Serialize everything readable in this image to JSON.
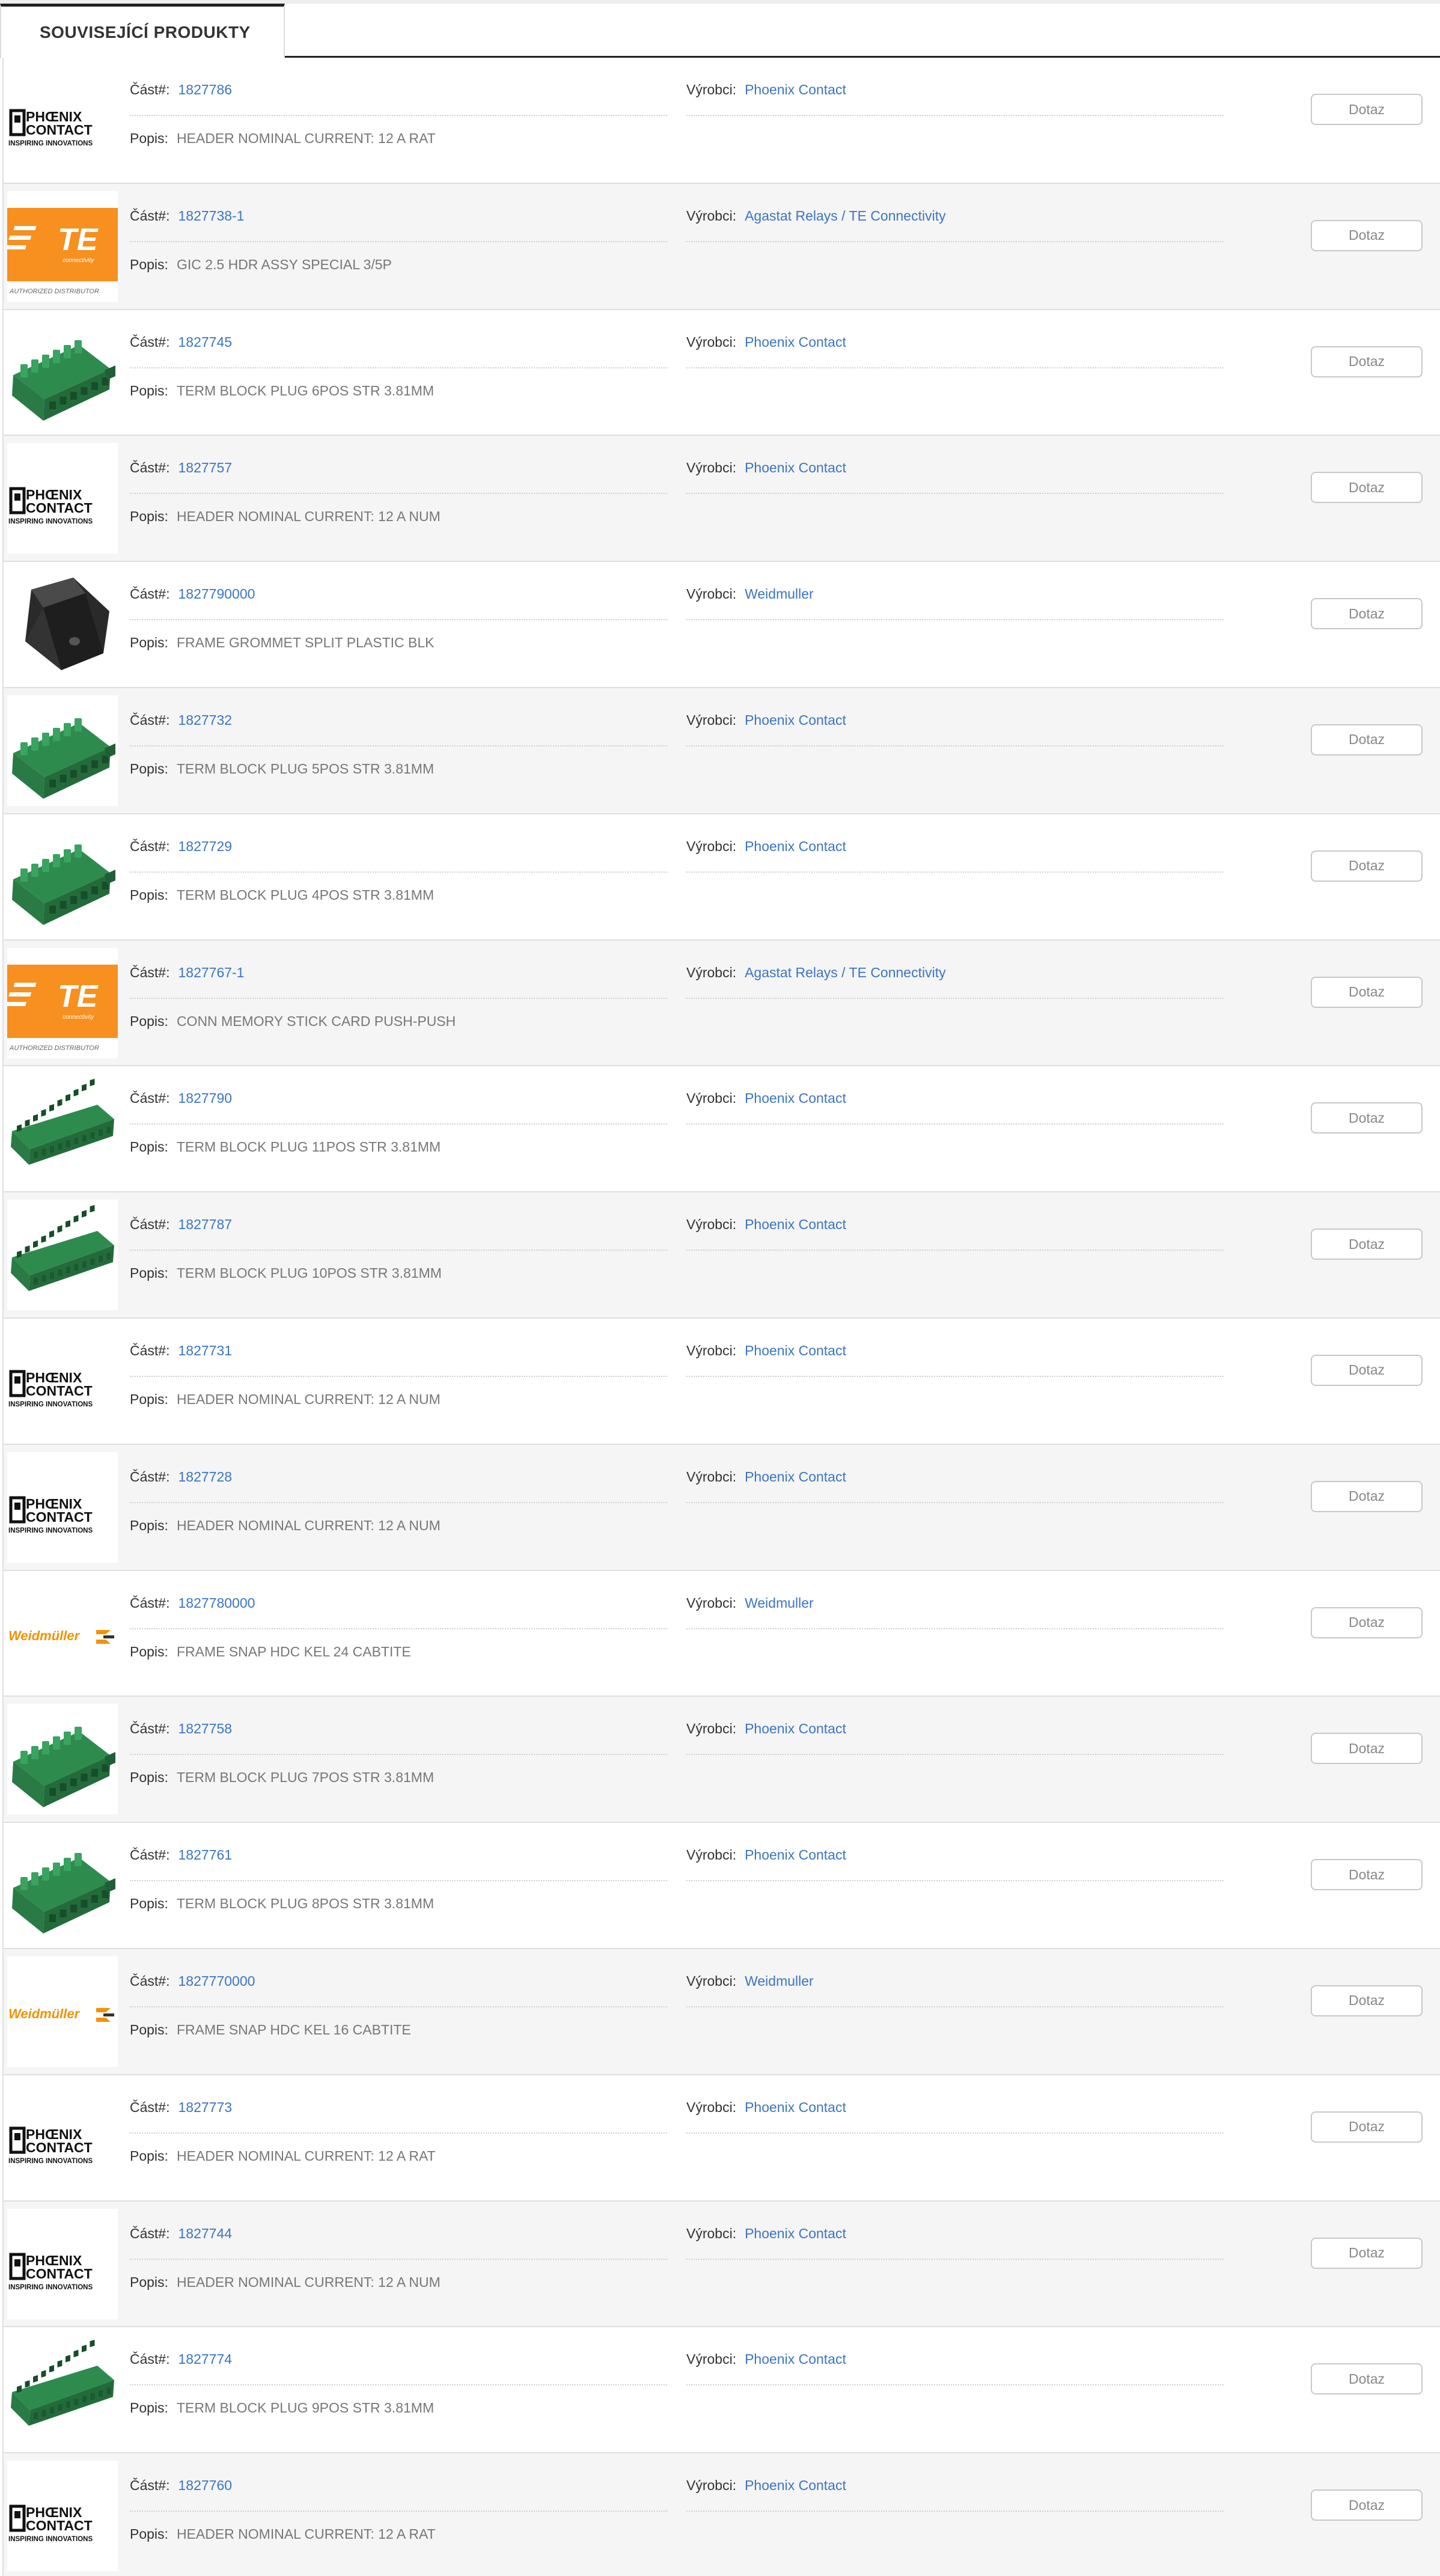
{
  "tab": {
    "label": "SOUVISEJÍCÍ PRODUKTY"
  },
  "labels": {
    "part": "Část#:",
    "manufacturer": "Výrobci:",
    "description": "Popis:",
    "button": "Dotaz"
  },
  "logo_text": {
    "phoenix_line1": "PHŒNIX",
    "phoenix_line2": "CONTACT",
    "phoenix_tagline": "INSPIRING INNOVATIONS",
    "te_main": "TE",
    "te_sub": "connectivity",
    "te_tagline": "AUTHORIZED DISTRIBUTOR",
    "weidmuller": "Weidmüller"
  },
  "colors": {
    "link": "#3a75c4",
    "te_orange": "#f7901e",
    "weidmuller_orange": "#f39200",
    "connector_green": "#2e8b4e"
  },
  "products": [
    {
      "part": "1827786",
      "manufacturer": "Phoenix Contact",
      "description": "HEADER NOMINAL CURRENT: 12 A RAT",
      "image": "phoenix-logo"
    },
    {
      "part": "1827738-1",
      "manufacturer": "Agastat Relays / TE Connectivity",
      "description": "GIC 2.5 HDR ASSY SPECIAL 3/5P",
      "image": "te-logo"
    },
    {
      "part": "1827745",
      "manufacturer": "Phoenix Contact",
      "description": "TERM BLOCK PLUG 6POS STR 3.81MM",
      "image": "green-plug"
    },
    {
      "part": "1827757",
      "manufacturer": "Phoenix Contact",
      "description": "HEADER NOMINAL CURRENT: 12 A NUM",
      "image": "phoenix-logo"
    },
    {
      "part": "1827790000",
      "manufacturer": "Weidmuller",
      "description": "FRAME GROMMET SPLIT PLASTIC BLK",
      "image": "black-grommet"
    },
    {
      "part": "1827732",
      "manufacturer": "Phoenix Contact",
      "description": "TERM BLOCK PLUG 5POS STR 3.81MM",
      "image": "green-plug"
    },
    {
      "part": "1827729",
      "manufacturer": "Phoenix Contact",
      "description": "TERM BLOCK PLUG 4POS STR 3.81MM",
      "image": "green-plug"
    },
    {
      "part": "1827767-1",
      "manufacturer": "Agastat Relays / TE Connectivity",
      "description": "CONN MEMORY STICK CARD PUSH-PUSH",
      "image": "te-logo"
    },
    {
      "part": "1827790",
      "manufacturer": "Phoenix Contact",
      "description": "TERM BLOCK PLUG 11POS STR 3.81MM",
      "image": "green-plug-long"
    },
    {
      "part": "1827787",
      "manufacturer": "Phoenix Contact",
      "description": "TERM BLOCK PLUG 10POS STR 3.81MM",
      "image": "green-plug-long"
    },
    {
      "part": "1827731",
      "manufacturer": "Phoenix Contact",
      "description": "HEADER NOMINAL CURRENT: 12 A NUM",
      "image": "phoenix-logo"
    },
    {
      "part": "1827728",
      "manufacturer": "Phoenix Contact",
      "description": "HEADER NOMINAL CURRENT: 12 A NUM",
      "image": "phoenix-logo"
    },
    {
      "part": "1827780000",
      "manufacturer": "Weidmuller",
      "description": "FRAME SNAP HDC KEL 24 CABTITE",
      "image": "weidmuller-logo"
    },
    {
      "part": "1827758",
      "manufacturer": "Phoenix Contact",
      "description": "TERM BLOCK PLUG 7POS STR 3.81MM",
      "image": "green-plug"
    },
    {
      "part": "1827761",
      "manufacturer": "Phoenix Contact",
      "description": "TERM BLOCK PLUG 8POS STR 3.81MM",
      "image": "green-plug"
    },
    {
      "part": "1827770000",
      "manufacturer": "Weidmuller",
      "description": "FRAME SNAP HDC KEL 16 CABTITE",
      "image": "weidmuller-logo"
    },
    {
      "part": "1827773",
      "manufacturer": "Phoenix Contact",
      "description": "HEADER NOMINAL CURRENT: 12 A RAT",
      "image": "phoenix-logo"
    },
    {
      "part": "1827744",
      "manufacturer": "Phoenix Contact",
      "description": "HEADER NOMINAL CURRENT: 12 A NUM",
      "image": "phoenix-logo"
    },
    {
      "part": "1827774",
      "manufacturer": "Phoenix Contact",
      "description": "TERM BLOCK PLUG 9POS STR 3.81MM",
      "image": "green-plug-long"
    },
    {
      "part": "1827760",
      "manufacturer": "Phoenix Contact",
      "description": "HEADER NOMINAL CURRENT: 12 A RAT",
      "image": "phoenix-logo"
    }
  ]
}
